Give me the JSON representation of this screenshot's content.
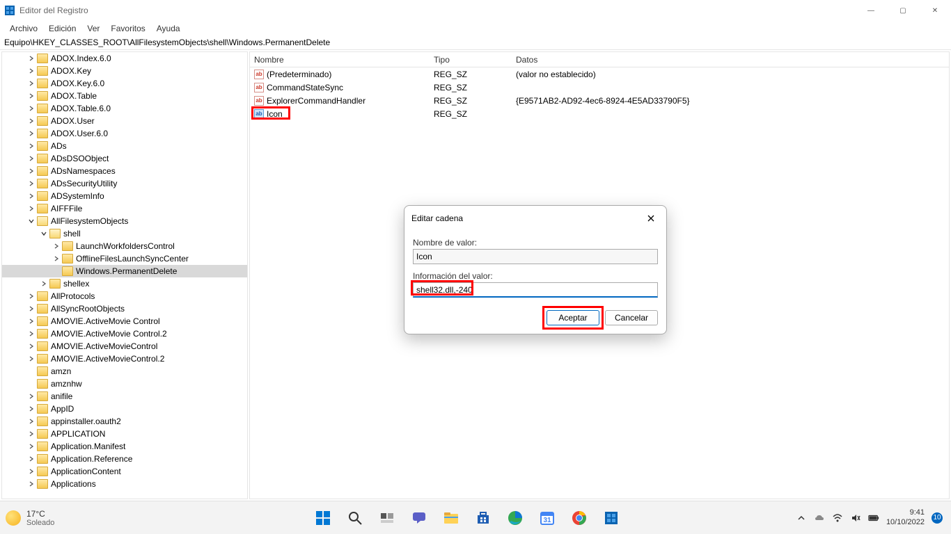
{
  "window": {
    "title": "Editor del Registro",
    "controls": {
      "min": "—",
      "max": "▢",
      "close": "✕"
    }
  },
  "menu": {
    "file": "Archivo",
    "edit": "Edición",
    "view": "Ver",
    "favorites": "Favoritos",
    "help": "Ayuda"
  },
  "address": "Equipo\\HKEY_CLASSES_ROOT\\AllFilesystemObjects\\shell\\Windows.PermanentDelete",
  "tree": [
    {
      "label": "ADOX.Index.6.0",
      "indent": 0,
      "chev": ">"
    },
    {
      "label": "ADOX.Key",
      "indent": 0,
      "chev": ">"
    },
    {
      "label": "ADOX.Key.6.0",
      "indent": 0,
      "chev": ">"
    },
    {
      "label": "ADOX.Table",
      "indent": 0,
      "chev": ">"
    },
    {
      "label": "ADOX.Table.6.0",
      "indent": 0,
      "chev": ">"
    },
    {
      "label": "ADOX.User",
      "indent": 0,
      "chev": ">"
    },
    {
      "label": "ADOX.User.6.0",
      "indent": 0,
      "chev": ">"
    },
    {
      "label": "ADs",
      "indent": 0,
      "chev": ">"
    },
    {
      "label": "ADsDSOObject",
      "indent": 0,
      "chev": ">"
    },
    {
      "label": "ADsNamespaces",
      "indent": 0,
      "chev": ">"
    },
    {
      "label": "ADsSecurityUtility",
      "indent": 0,
      "chev": ">"
    },
    {
      "label": "ADSystemInfo",
      "indent": 0,
      "chev": ">"
    },
    {
      "label": "AIFFFile",
      "indent": 0,
      "chev": ">"
    },
    {
      "label": "AllFilesystemObjects",
      "indent": 0,
      "chev": "v",
      "open": true
    },
    {
      "label": "shell",
      "indent": 1,
      "chev": "v",
      "open": true
    },
    {
      "label": "LaunchWorkfoldersControl",
      "indent": 2,
      "chev": ">"
    },
    {
      "label": "OfflineFilesLaunchSyncCenter",
      "indent": 2,
      "chev": ">"
    },
    {
      "label": "Windows.PermanentDelete",
      "indent": 2,
      "chev": "",
      "selected": true
    },
    {
      "label": "shellex",
      "indent": 1,
      "chev": ">"
    },
    {
      "label": "AllProtocols",
      "indent": 0,
      "chev": ">"
    },
    {
      "label": "AllSyncRootObjects",
      "indent": 0,
      "chev": ">"
    },
    {
      "label": "AMOVIE.ActiveMovie Control",
      "indent": 0,
      "chev": ">"
    },
    {
      "label": "AMOVIE.ActiveMovie Control.2",
      "indent": 0,
      "chev": ">"
    },
    {
      "label": "AMOVIE.ActiveMovieControl",
      "indent": 0,
      "chev": ">"
    },
    {
      "label": "AMOVIE.ActiveMovieControl.2",
      "indent": 0,
      "chev": ">"
    },
    {
      "label": "amzn",
      "indent": 0,
      "chev": ""
    },
    {
      "label": "amznhw",
      "indent": 0,
      "chev": ""
    },
    {
      "label": "anifile",
      "indent": 0,
      "chev": ">"
    },
    {
      "label": "AppID",
      "indent": 0,
      "chev": ">"
    },
    {
      "label": "appinstaller.oauth2",
      "indent": 0,
      "chev": ">"
    },
    {
      "label": "APPLICATION",
      "indent": 0,
      "chev": ">"
    },
    {
      "label": "Application.Manifest",
      "indent": 0,
      "chev": ">"
    },
    {
      "label": "Application.Reference",
      "indent": 0,
      "chev": ">"
    },
    {
      "label": "ApplicationContent",
      "indent": 0,
      "chev": ">"
    },
    {
      "label": "Applications",
      "indent": 0,
      "chev": ">"
    }
  ],
  "list": {
    "columns": {
      "name": "Nombre",
      "type": "Tipo",
      "data": "Datos"
    },
    "rows": [
      {
        "name": "(Predeterminado)",
        "type": "REG_SZ",
        "data": "(valor no establecido)"
      },
      {
        "name": "CommandStateSync",
        "type": "REG_SZ",
        "data": ""
      },
      {
        "name": "ExplorerCommandHandler",
        "type": "REG_SZ",
        "data": "{E9571AB2-AD92-4ec6-8924-4E5AD33790F5}"
      },
      {
        "name": "Icon",
        "type": "REG_SZ",
        "data": "",
        "highlighted": true
      }
    ]
  },
  "dialog": {
    "title": "Editar cadena",
    "name_label": "Nombre de valor:",
    "name_value": "Icon",
    "value_label": "Información del valor:",
    "value_value": "shell32.dll,-240",
    "ok": "Aceptar",
    "cancel": "Cancelar"
  },
  "taskbar": {
    "weather_temp": "17°C",
    "weather_desc": "Soleado",
    "time": "9:41",
    "date": "10/10/2022",
    "badge": "10"
  }
}
